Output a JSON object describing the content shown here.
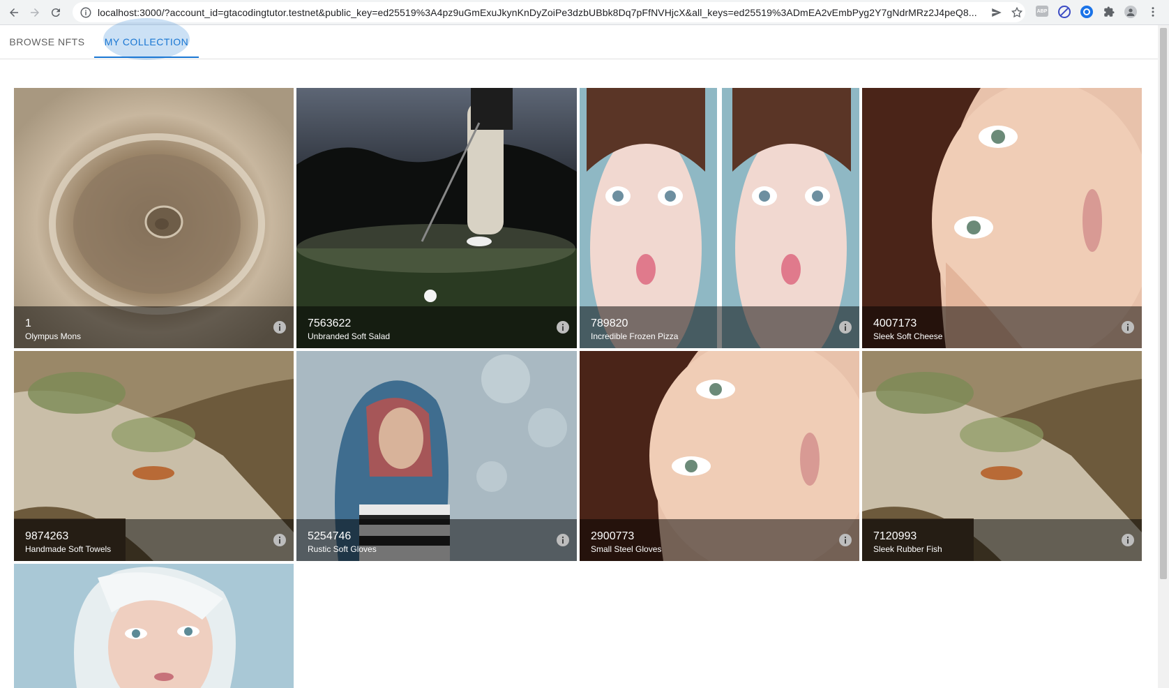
{
  "browser": {
    "url": "localhost:3000/?account_id=gtacodingtutor.testnet&public_key=ed25519%3A4pz9uGmExuJkynKnDyZoiPe3dzbUBbk8Dq7pFfNVHjcX&all_keys=ed25519%3ADmEA2vEmbPyg2Y7gNdrMRz2J4peQ8..."
  },
  "tabs": [
    {
      "label": "BROWSE NFTS",
      "selected": false
    },
    {
      "label": "MY COLLECTION",
      "selected": true
    }
  ],
  "accent_color": "#1976d2",
  "tiles": [
    {
      "id": "1",
      "name": "Olympus Mons",
      "image": "mars-volcano-crater"
    },
    {
      "id": "7563622",
      "name": "Unbranded Soft Salad",
      "image": "golfer-putting-at-night"
    },
    {
      "id": "789820",
      "name": "Incredible Frozen Pizza",
      "image": "twin-portrait-fish-face"
    },
    {
      "id": "4007173",
      "name": "Sleek Soft Cheese",
      "image": "woman-portrait-closeup"
    },
    {
      "id": "9874263",
      "name": "Handmade Soft Towels",
      "image": "lichen-rock-lizard"
    },
    {
      "id": "5254746",
      "name": "Rustic Soft Gloves",
      "image": "woman-in-scarf-bokeh"
    },
    {
      "id": "2900773",
      "name": "Small Steel Gloves",
      "image": "woman-portrait-closeup"
    },
    {
      "id": "7120993",
      "name": "Sleek Rubber Fish",
      "image": "lichen-rock-lizard"
    },
    {
      "id": "",
      "name": "",
      "image": "white-haired-girl-portrait"
    }
  ]
}
